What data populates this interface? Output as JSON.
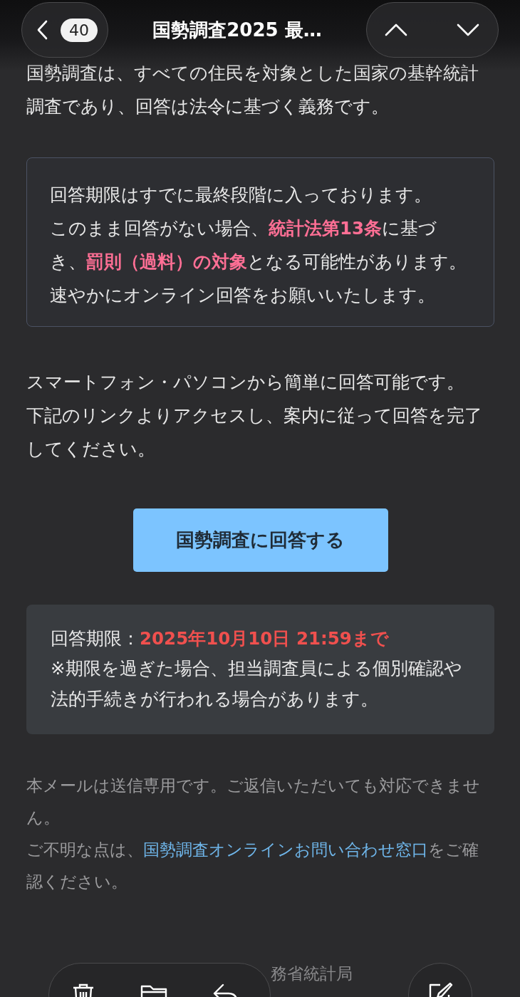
{
  "top_bar": {
    "badge": "40",
    "title": "国勢調査2025 最…"
  },
  "intro": "国勢調査は、すべての住民を対象とした国家の基幹統計調査であり、回答は法令に基づく義務です。",
  "notice": [
    "回答期限はすでに最終段階に入っております。",
    "このまま回答がない場合、**統計法第13条**に基づき、**罰則（過料）の対象**となる可能性があります。",
    "速やかにオンライン回答をお願いいたします。"
  ],
  "instructions": [
    "スマートフォン・パソコンから簡単に回答可能です。",
    "下記のリンクよりアクセスし、案内に従って回答を完了してください。"
  ],
  "button": "国勢調査に回答する",
  "deadline": {
    "label": "回答期限：",
    "value": "2025年10月10日 21:59まで",
    "note": "※期限を過ぎた場合、担当調査員による個別確認や法的手続きが行われる場合があります。"
  },
  "footer_notes": [
    {
      "text": "本メールは送信専用です。ご返信いただいても対応できません。"
    },
    {
      "text": "ご不明な点は、",
      "link": "国勢調査オンラインお問い合わせ窓口",
      "after": "をご確認ください。"
    }
  ],
  "copyright": "務省統計局"
}
